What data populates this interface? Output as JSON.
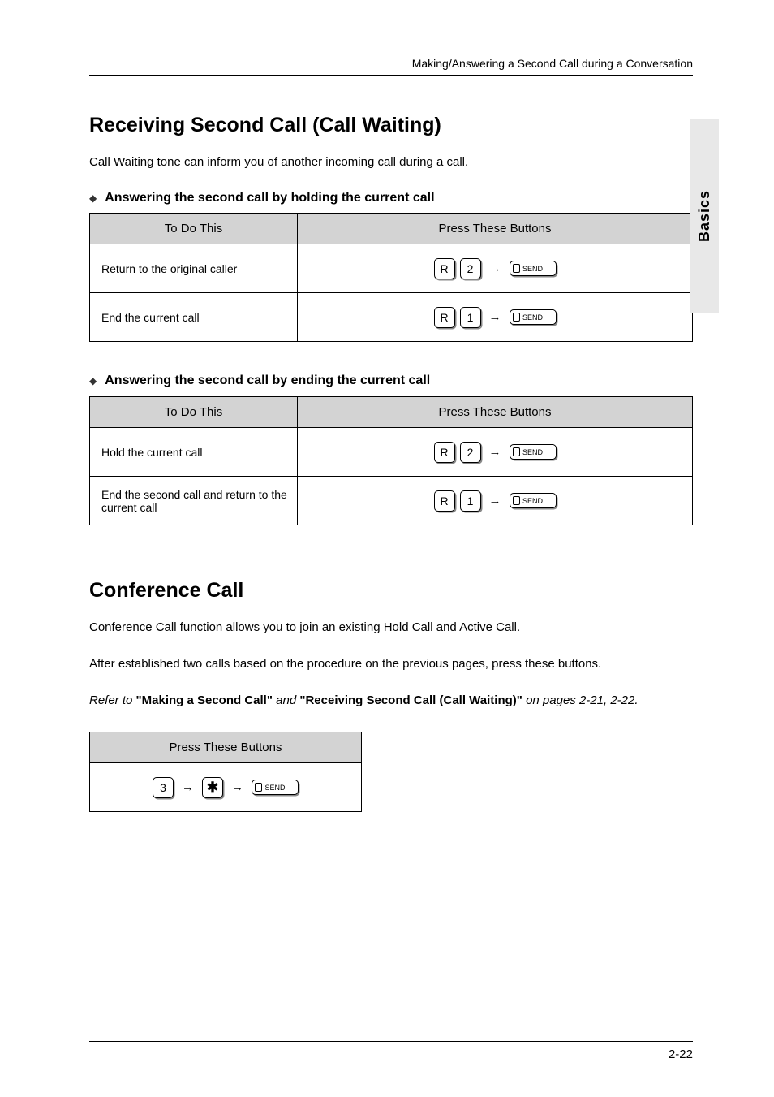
{
  "header": {
    "running": "Making/Answering a Second Call during a Conversation"
  },
  "sideTab": "Basics",
  "section1": {
    "title": "Receiving Second Call (Call Waiting)",
    "lead": "Call Waiting tone can inform you of another incoming call during a call.",
    "sub": "Answering the second call by holding the current call",
    "table": {
      "h1": "To Do This",
      "h2": "Press These Buttons",
      "rows": [
        {
          "label": "Return to the original caller",
          "k1": "R",
          "k2": "2",
          "k3": "SEND"
        },
        {
          "label": "End the current call",
          "k1": "R",
          "k2": "1",
          "k3": "SEND"
        }
      ]
    }
  },
  "section2": {
    "sub": "Answering the second call by ending the current call",
    "table": {
      "h1": "To Do This",
      "h2": "Press These Buttons",
      "rows": [
        {
          "label": "Hold the current call",
          "k1": "R",
          "k2": "2",
          "k3": "SEND"
        },
        {
          "label": "End the second call and return to the current call",
          "k1": "R",
          "k2": "1",
          "k3": "SEND"
        }
      ]
    }
  },
  "section3": {
    "title": "Conference Call",
    "lead": "Conference Call function allows you to join an existing Hold Call and Active Call.",
    "body": "After established two calls based on the procedure on the previous pages, press these buttons.",
    "ref_prefix": "Refer to",
    "ref_bold": "\"Making a Second Call\"",
    "ref_and": "and",
    "ref_bold2": "\"Receiving Second Call (Call Waiting)\"",
    "ref_on": "on",
    "ref_pages": "pages 2-21, 2-22.",
    "table": {
      "h1": "Press These Buttons",
      "row": {
        "k1": "3",
        "k2": "✱",
        "k3": "SEND"
      }
    }
  },
  "pageNumber": "2-22"
}
